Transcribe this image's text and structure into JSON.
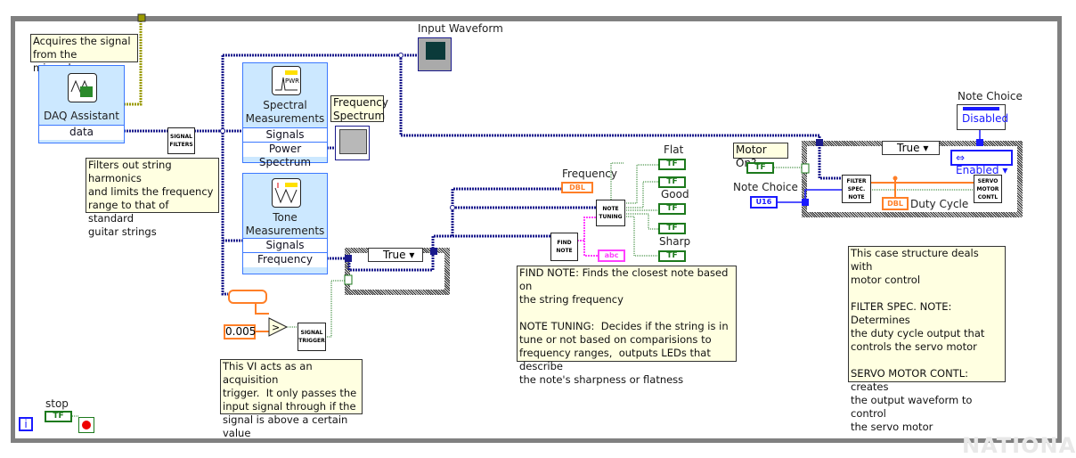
{
  "comments": {
    "daq": "Acquires the signal\nfrom the microphone",
    "filters": "Filters out string harmonics\nand limits the frequency\nrange to that of standard\nguitar strings",
    "trigger": "This VI acts as an acquisition\ntrigger.  It only passes the\ninput signal through if the\nsignal is above a certain value",
    "notes": "FIND NOTE: Finds the closest note based on\nthe string frequency\n\nNOTE TUNING:  Decides if the string is in\ntune or not based on comparisions to\nfrequency ranges,  outputs LEDs that describe\nthe note's sharpness or flatness",
    "motor": "This case structure deals with\nmotor control\n\nFILTER SPEC. NOTE:  Determines\nthe duty cycle output that\ncontrols the servo motor\n\nSERVO MOTOR CONTL:  creates\nthe output waveform to control\nthe servo motor"
  },
  "daq_assistant": {
    "title": "DAQ Assistant",
    "output": "data"
  },
  "spectral": {
    "title": "Spectral\nMeasurements",
    "input": "Signals",
    "output": "Power Spectrum"
  },
  "tone": {
    "title": "Tone\nMeasurements",
    "input": "Signals",
    "output": "Frequency"
  },
  "subvis": {
    "signal_filters": "SIGNAL\nFILTERS",
    "signal_trigger": "SIGNAL\nTRIGGER",
    "find_note": "FIND\nNOTE",
    "note_tuning": "NOTE\nTUNING",
    "filter_spec": "FILTER\nSPEC.\nNOTE",
    "servo": "SERVO\nMOTOR\nCONTL"
  },
  "indicators": {
    "input_waveform": "Input Waveform",
    "frequency_spectrum": "Frequency\nSpectrum",
    "frequency": "Frequency",
    "dbl": "DBL",
    "abc": "abc",
    "flat": "Flat",
    "good": "Good",
    "sharp": "Sharp",
    "tf": "TF",
    "duty_cycle": "Duty Cycle",
    "stop": "stop"
  },
  "controls": {
    "threshold": "0.005",
    "motor_on": "Motor On?",
    "note_choice": "Note Choice",
    "u16": "U16",
    "note_choice_top": "Note Choice",
    "disabled": "Disabled",
    "enabled": "Enabled"
  },
  "case1": {
    "selector": "True"
  },
  "case2": {
    "selector": "True"
  },
  "iteration": "i",
  "watermark": "NATIONAL",
  "colors": {
    "wire_waveform": "#1a1a8c",
    "wire_bool": "#1d7a1d",
    "wire_dbl": "#ff7f27",
    "wire_string": "#ff40ff",
    "wire_u16": "#1a1aff",
    "comment_bg": "#ffffe1"
  }
}
